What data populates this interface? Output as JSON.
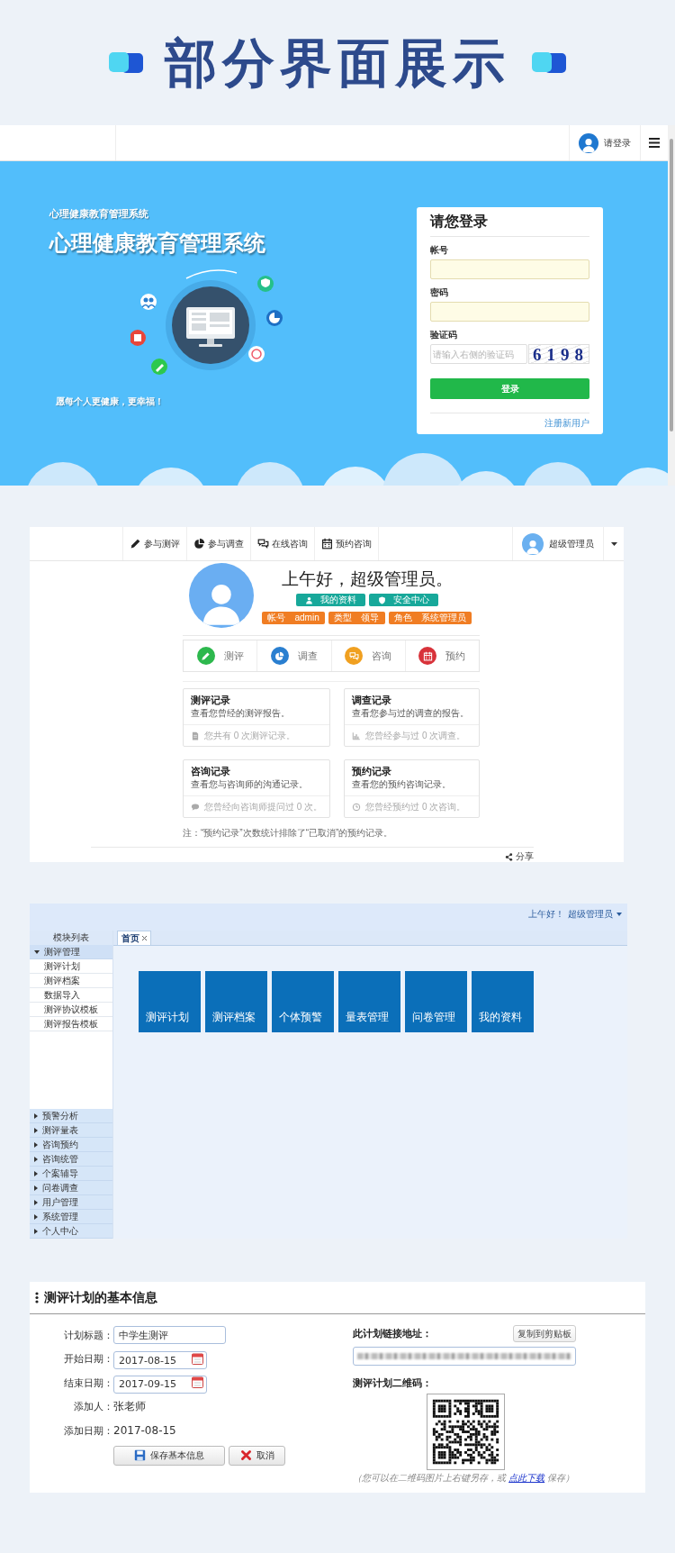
{
  "heading": {
    "title": "部分界面展示"
  },
  "login_screen": {
    "nav": {
      "user_label": "请登录"
    },
    "banner": {
      "subtitle": "心理健康教育管理系统",
      "title": "心理健康教育管理系统",
      "slogan": "愿每个人更健康，更幸福！"
    },
    "login_card": {
      "title": "请您登录",
      "fields": [
        {
          "label": "帐号",
          "kind": "account"
        },
        {
          "label": "密码",
          "kind": "password"
        },
        {
          "label": "验证码",
          "kind": "captcha",
          "placeholder": "请输入右侧的验证码",
          "captcha": "6198"
        }
      ],
      "button": "登录",
      "register_link": "注册新用户"
    }
  },
  "dashboard_screen": {
    "nav_items": [
      {
        "label": "参与测评",
        "kind": "pencil"
      },
      {
        "label": "参与调查",
        "kind": "pie"
      },
      {
        "label": "在线咨询",
        "kind": "chat"
      },
      {
        "label": "预约咨询",
        "kind": "calendar"
      }
    ],
    "user": "超级管理员",
    "greeting": "上午好，超级管理员。",
    "buttons": [
      {
        "label": "我的资料",
        "kind": "user"
      },
      {
        "label": "安全中心",
        "kind": "shield"
      }
    ],
    "tags": [
      {
        "key": "帐号",
        "value": "admin"
      },
      {
        "key": "类型",
        "value": "领导"
      },
      {
        "key": "角色",
        "value": "系统管理员"
      }
    ],
    "shortcuts": [
      {
        "label": "测评",
        "kind": "pencil",
        "color": "#2db84d"
      },
      {
        "label": "调查",
        "kind": "pie",
        "color": "#2a7fd0"
      },
      {
        "label": "咨询",
        "kind": "chat",
        "color": "#f0a020"
      },
      {
        "label": "预约",
        "kind": "calendar",
        "color": "#d8323a"
      }
    ],
    "cards": [
      {
        "title": "测评记录",
        "description": "查看您曾经的测评报告。",
        "footer": "您共有 0 次测评记录。",
        "kind": "file"
      },
      {
        "title": "调查记录",
        "description": "查看您参与过的调查的报告。",
        "footer": "您曾经参与过 0 次调查。",
        "kind": "chart"
      },
      {
        "title": "咨询记录",
        "description": "查看您与咨询师的沟通记录。",
        "footer": "您曾经向咨询师提问过 0 次。",
        "kind": "comment"
      },
      {
        "title": "预约记录",
        "description": "查看您的预约咨询记录。",
        "footer": "您曾经预约过 0 次咨询。",
        "kind": "clock"
      }
    ],
    "note": "注：“预约记录”次数统计排除了“已取消”的预约记录。",
    "share": "分享"
  },
  "admin_screen": {
    "greeting": "上午好！",
    "user": "超级管理员",
    "sidebar": {
      "title": "模块列表",
      "groups": [
        {
          "label": "测评管理",
          "expanded": true,
          "children": [
            {
              "label": "测评计划"
            },
            {
              "label": "测评档案"
            },
            {
              "label": "数据导入"
            },
            {
              "label": "测评协议模板"
            },
            {
              "label": "测评报告模板"
            }
          ]
        },
        {
          "label": "预警分析",
          "expanded": false
        },
        {
          "label": "测评量表",
          "expanded": false
        },
        {
          "label": "咨询预约",
          "expanded": false
        },
        {
          "label": "咨询统管",
          "expanded": false
        },
        {
          "label": "个案辅导",
          "expanded": false
        },
        {
          "label": "问卷调查",
          "expanded": false
        },
        {
          "label": "用户管理",
          "expanded": false
        },
        {
          "label": "系统管理",
          "expanded": false
        },
        {
          "label": "个人中心",
          "expanded": false
        }
      ]
    },
    "tabs": [
      {
        "label": "首页",
        "selected": true
      }
    ],
    "tiles": [
      "测评计划",
      "测评档案",
      "个体预警",
      "量表管理",
      "问卷管理",
      "我的资料"
    ]
  },
  "plan_screen": {
    "title": "测评计划的基本信息",
    "fields": [
      {
        "label": "计划标题：",
        "kind": "text",
        "value": "中学生测评"
      },
      {
        "label": "开始日期：",
        "kind": "date",
        "value": "2017-08-15"
      },
      {
        "label": "结束日期：",
        "kind": "date",
        "value": "2017-09-15"
      },
      {
        "label": "添加人：",
        "kind": "static",
        "value": "张老师"
      },
      {
        "label": "添加日期：",
        "kind": "static",
        "value": "2017-08-15"
      }
    ],
    "buttons": [
      {
        "label": "保存基本信息",
        "kind": "save"
      },
      {
        "label": "取消",
        "kind": "cancel"
      }
    ],
    "link_label": "此计划链接地址：",
    "copy_button": "复制到剪贴板",
    "qr_label": "测评计划二维码：",
    "qr_hint_before": "（您可以在二维码图片上右键另存，或",
    "qr_hint_link": "点此下载",
    "qr_hint_after": "保存）"
  }
}
